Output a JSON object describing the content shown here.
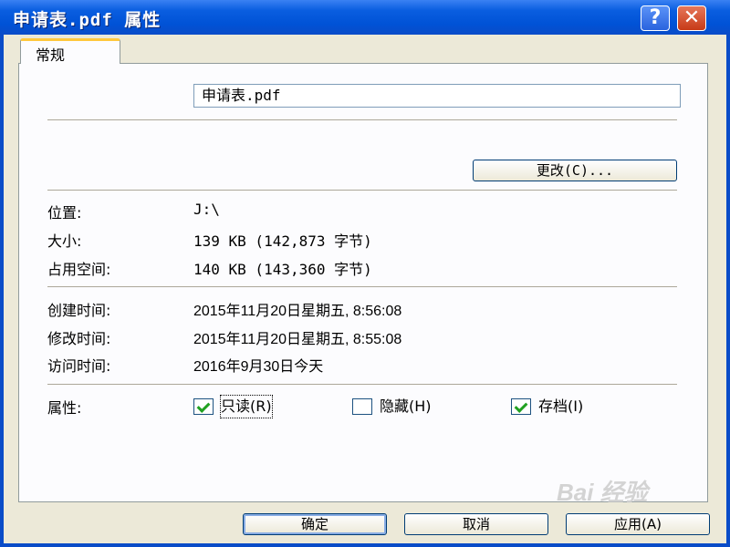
{
  "window": {
    "title": "申请表.pdf  属性",
    "help_glyph": "?",
    "close_glyph": "✕"
  },
  "tabs": [
    {
      "label": "常规",
      "active": true
    }
  ],
  "general": {
    "file_name": "申请表.pdf",
    "change_button": "更改(C)...",
    "location_label": "位置:",
    "location_value": "J:\\",
    "size_label": "大小:",
    "size_value": "139 KB (142,873 字节)",
    "size_on_disk_label": "占用空间:",
    "size_on_disk_value": "140 KB (143,360 字节)",
    "created_label": "创建时间:",
    "created_value": "2015年11月20日星期五, 8:56:08",
    "modified_label": "修改时间:",
    "modified_value": "2015年11月20日星期五, 8:55:08",
    "accessed_label": "访问时间:",
    "accessed_value": "2016年9月30日今天",
    "attributes_label": "属性:",
    "attributes": [
      {
        "label": "只读(R)",
        "checked": true
      },
      {
        "label": "隐藏(H)",
        "checked": false
      },
      {
        "label": "存档(I)",
        "checked": true
      }
    ]
  },
  "buttons": {
    "ok": "确定",
    "cancel": "取消",
    "apply": "应用(A)"
  },
  "watermark": "Bai 经验",
  "colors": {
    "titlebar": "#0052d6",
    "dialog_bg": "#ece9d8",
    "panel_bg": "#fcfcfe",
    "tab_highlight": "#ffc83c",
    "checkmark": "#21a121",
    "close_button": "#c73a17"
  }
}
